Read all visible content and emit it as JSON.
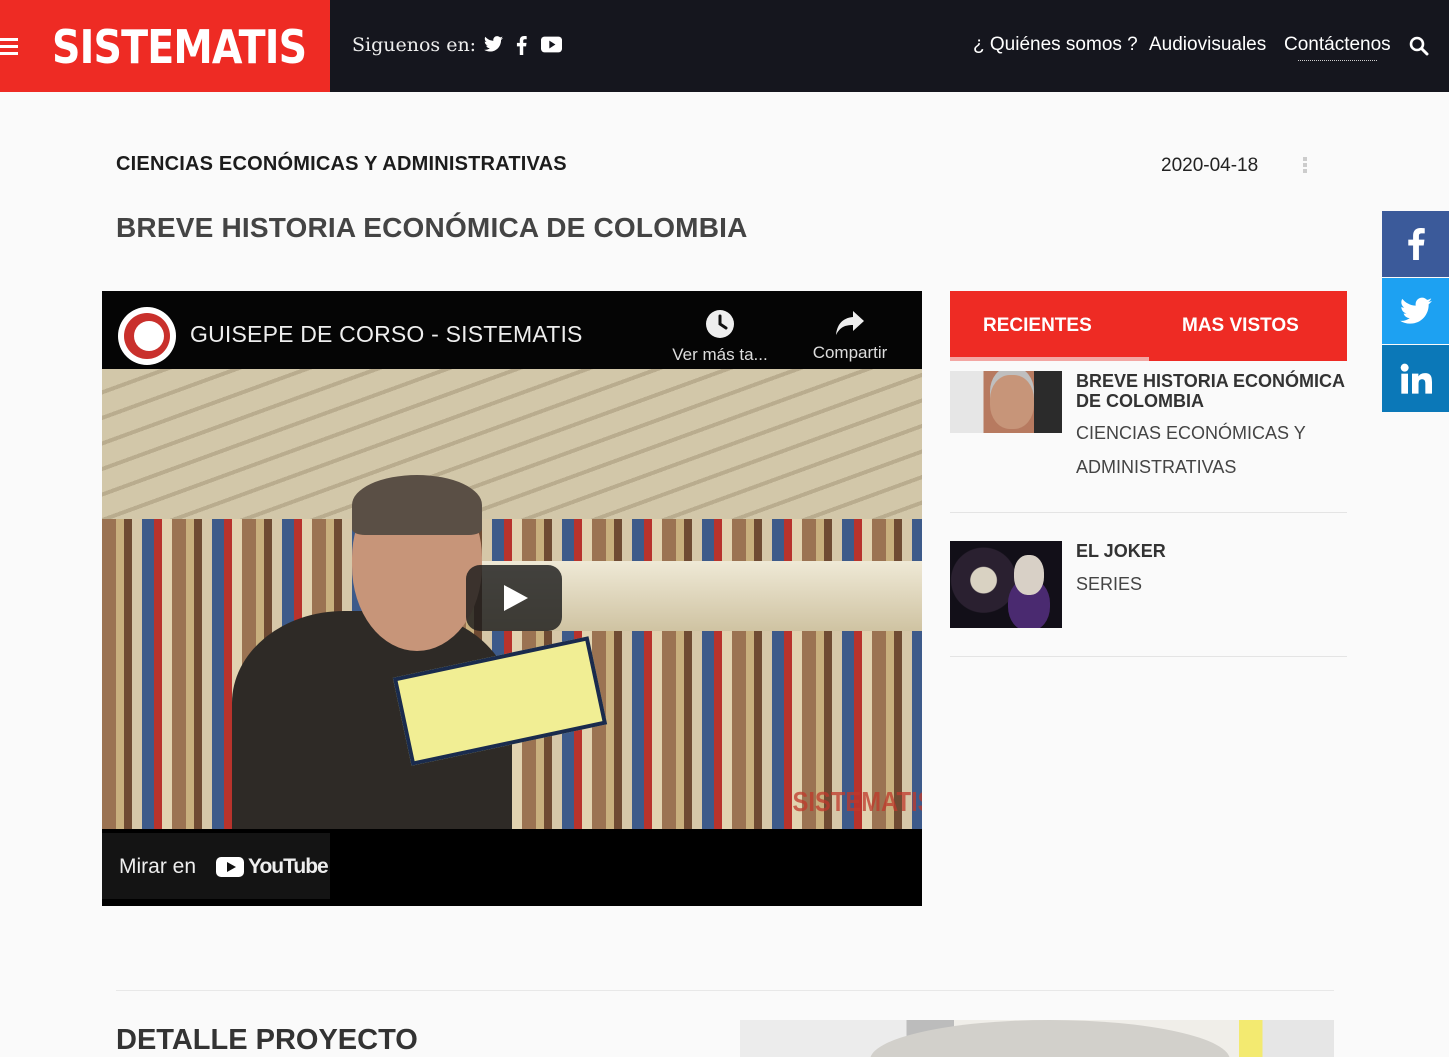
{
  "header": {
    "logo": "SISTEMATIS",
    "follow_label": "Siguenos en:",
    "nav": [
      {
        "label": "¿ Quiénes somos ?"
      },
      {
        "label": "Audiovisuales"
      },
      {
        "label": "Contáctenos"
      }
    ],
    "social": [
      "twitter-icon",
      "facebook-icon",
      "youtube-icon"
    ]
  },
  "article": {
    "category": "CIENCIAS ECONÓMICAS Y ADMINISTRATIVAS",
    "date": "2020-04-18",
    "title": "BREVE HISTORIA ECONÓMICA DE COLOMBIA"
  },
  "video": {
    "channel_title": "GUISEPE DE CORSO - SISTEMATIS",
    "watch_later": "Ver más ta...",
    "share": "Compartir",
    "watch_on": "Mirar en",
    "youtube_word": "YouTube",
    "watermark": "SISTEMATIS"
  },
  "sidebar": {
    "tabs": [
      {
        "label": "RECIENTES"
      },
      {
        "label": "MAS VISTOS"
      }
    ],
    "items": [
      {
        "title": "BREVE HISTORIA ECONÓMICA DE COLOMBIA",
        "category": "CIENCIAS ECONÓMICAS Y ADMINISTRATIVAS"
      },
      {
        "title": "EL JOKER",
        "category": "SERIES"
      }
    ]
  },
  "share_bar": [
    "facebook-icon",
    "twitter-icon",
    "linkedin-icon"
  ],
  "colors": {
    "brand_red": "#ee2b24",
    "header_dark": "#15161e",
    "facebook": "#3b5a9a",
    "twitter": "#1da1f2",
    "linkedin": "#0b78b8"
  },
  "detail": {
    "title": "DETALLE PROYECTO"
  }
}
